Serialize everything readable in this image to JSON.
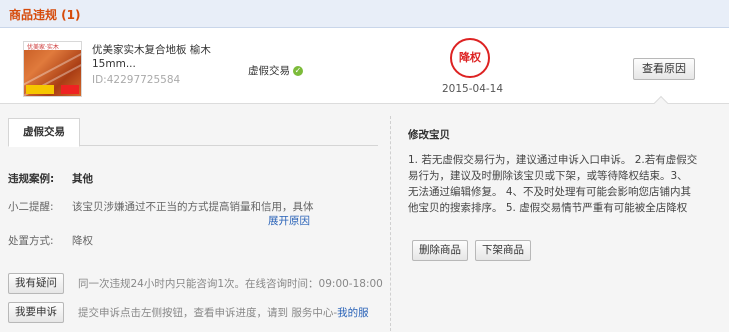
{
  "header": {
    "title": "商品违规 (1)"
  },
  "item": {
    "thumb_brand": "优美家·实木",
    "name": "优美家实木复合地板 榆木15mm...",
    "id_text": "ID:42297725584",
    "violation_type": "虚假交易",
    "ok_icon": "check-icon",
    "stamp": "降权",
    "date": "2015-04-14",
    "reason_button": "查看原因"
  },
  "detail": {
    "tab": "虚假交易",
    "case_label": "违规案例:",
    "case_value": "其他",
    "tip_label": "小二提醒:",
    "tip_value": "该宝贝涉嫌通过不正当的方式提高销量和信用，具体",
    "expand_link": "展开原因",
    "method_label": "处置方式:",
    "method_value": "降权",
    "ask_button": "我有疑问",
    "ask_text": "同一次违规24小时内只能咨询1次。在线咨询时间：09:00-18:00",
    "appeal_button": "我要申诉",
    "appeal_text": "提交申诉点击左侧按钮，查看申诉进度，请到 服务中心-",
    "appeal_link": "我的服"
  },
  "fix": {
    "title": "修改宝贝",
    "text": "1. 若无虚假交易行为，建议通过申诉入口申诉。 2.若有虚假交易行为，建议及时删除该宝贝或下架，或等待降权结束。3、无法通过编辑修复。 4、不及时处理有可能会影响您店铺内其他宝贝的搜索排序。 5. 虚假交易情节严重有可能被全店降权",
    "delete_button": "删除商品",
    "offshelf_button": "下架商品"
  }
}
